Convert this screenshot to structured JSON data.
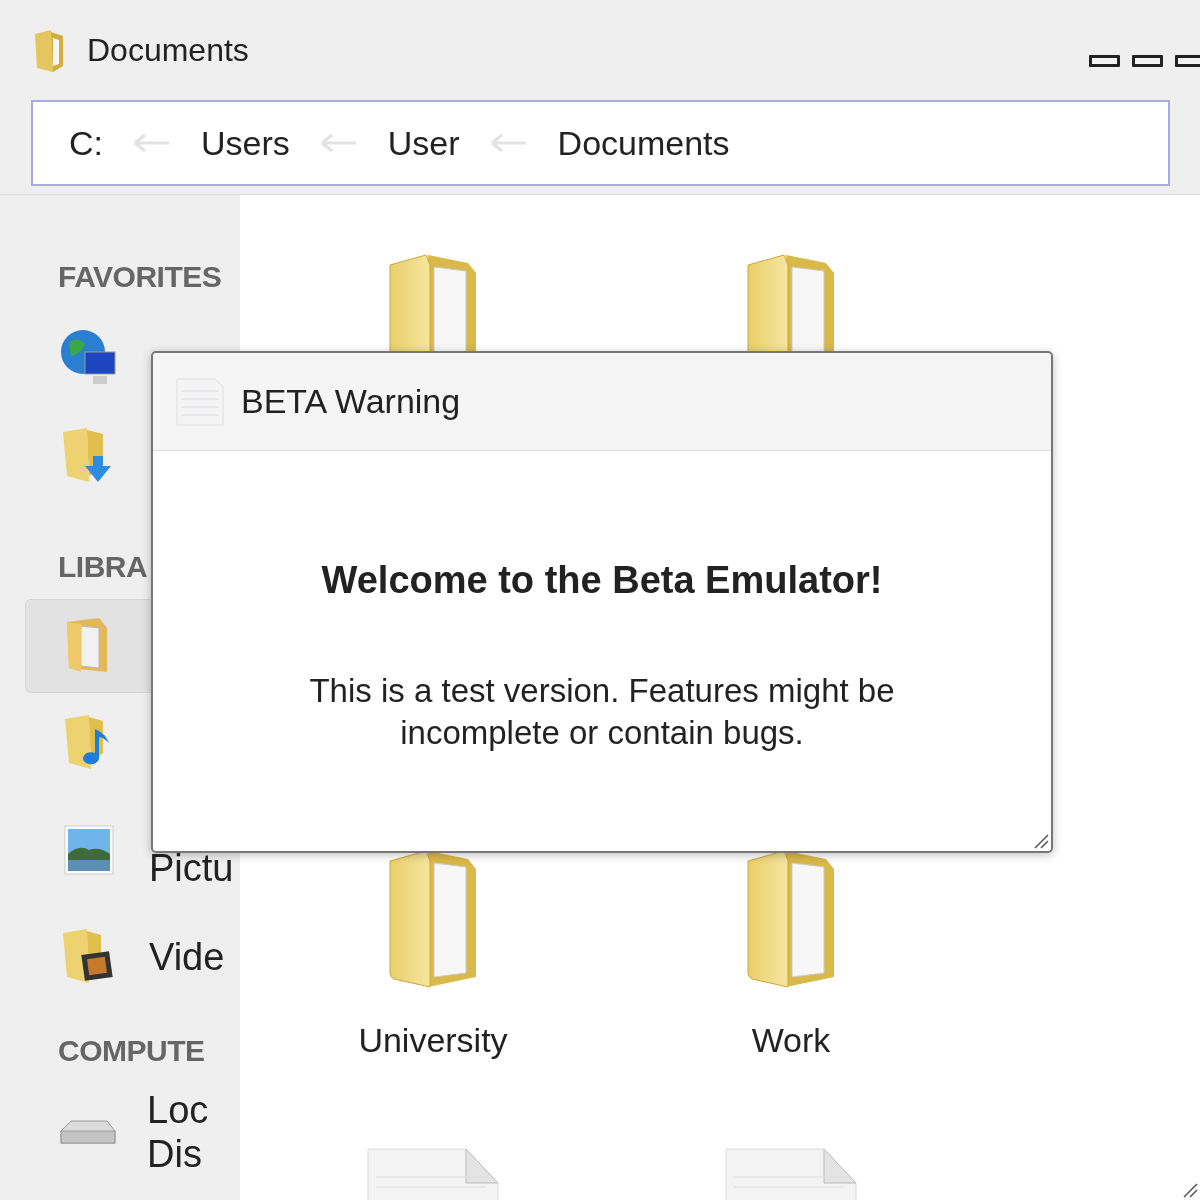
{
  "window": {
    "title": "Documents"
  },
  "address_bar": {
    "segments": [
      "C:",
      "Users",
      "User",
      "Documents"
    ]
  },
  "sidebar": {
    "sections": [
      {
        "heading": "FAVORITES",
        "items": [
          {
            "kind": "globe",
            "selected": false
          },
          {
            "kind": "downloads",
            "selected": false
          }
        ]
      },
      {
        "heading": "LIBRA",
        "items": [
          {
            "kind": "documents",
            "selected": true
          },
          {
            "kind": "music",
            "selected": false
          },
          {
            "kind": "pictures",
            "label": "Pictu",
            "selected": false
          },
          {
            "kind": "videos",
            "label": "Vide",
            "selected": false
          }
        ]
      },
      {
        "heading": "COMPUTE",
        "items": [
          {
            "kind": "disk",
            "label": "Loc Dis",
            "selected": false
          }
        ]
      }
    ]
  },
  "folder_view": {
    "items": [
      {
        "kind": "folder"
      },
      {
        "kind": "folder"
      },
      {
        "kind": "folder",
        "name": "University"
      },
      {
        "kind": "folder",
        "name": "Work"
      },
      {
        "kind": "document"
      },
      {
        "kind": "document"
      }
    ]
  },
  "dialog": {
    "title": "BETA Warning",
    "heading": "Welcome to the Beta Emulator!",
    "message": "This is a test version. Features might be incomplete or contain bugs."
  }
}
